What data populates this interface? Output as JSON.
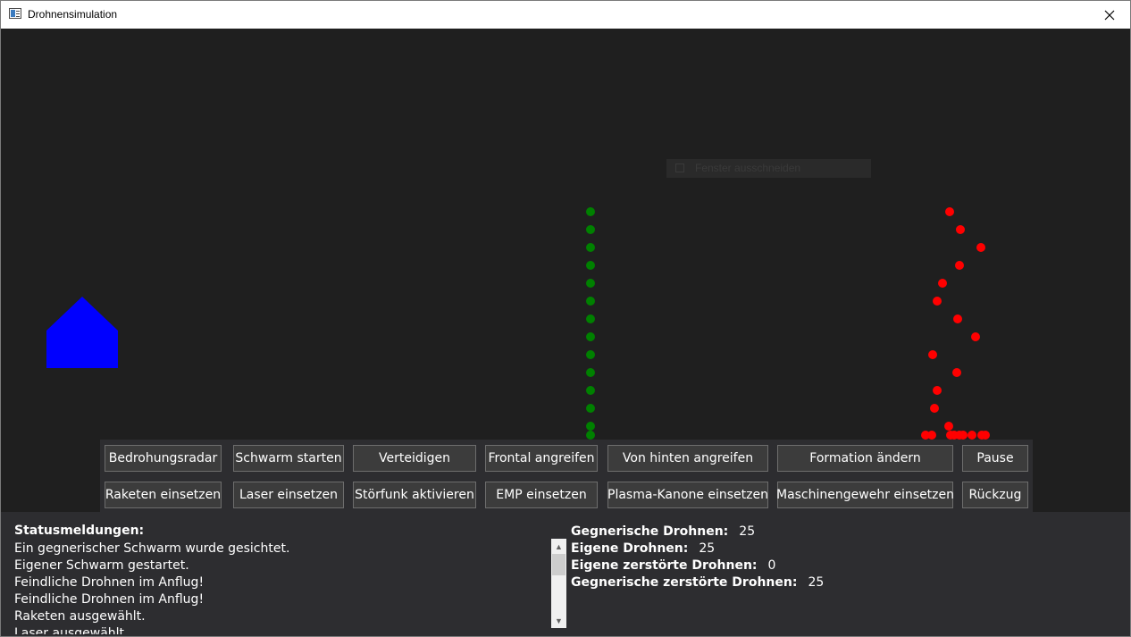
{
  "window": {
    "title": "Drohnensimulation",
    "icon": "app-window-icon",
    "close_icon": "close-icon"
  },
  "canvas": {
    "background": "#1f1f1f",
    "tooltip_text": "Fenster ausschneiden",
    "base": {
      "shape": "house",
      "color": "#0000ff"
    },
    "own_drones": {
      "color": "#008000",
      "count_visible": 14
    },
    "enemy_drones": {
      "color": "#ff0000",
      "count_visible": 22
    }
  },
  "buttons": {
    "row1": [
      "Bedrohungsradar",
      "Schwarm starten",
      "Verteidigen",
      "Frontal angreifen",
      "Von hinten angreifen",
      "Formation ändern",
      "Pause"
    ],
    "row2": [
      "Raketen einsetzen",
      "Laser einsetzen",
      "Störfunk aktivieren",
      "EMP einsetzen",
      "Plasma-Kanone einsetzen",
      "Maschinengewehr einsetzen",
      "Rückzug"
    ]
  },
  "status": {
    "heading": "Statusmeldungen:",
    "messages": [
      "Ein gegnerischer Schwarm wurde gesichtet.",
      "Eigener Schwarm gestartet.",
      "Feindliche Drohnen im Anflug!",
      "Feindliche Drohnen im Anflug!",
      "Raketen ausgewählt.",
      "Laser ausgewählt."
    ]
  },
  "stats": {
    "enemy_drones_label": "Gegnerische Drohnen:",
    "enemy_drones_value": "25",
    "own_drones_label": "Eigene Drohnen:",
    "own_drones_value": "25",
    "own_destroyed_label": "Eigene zerstörte Drohnen:",
    "own_destroyed_value": "0",
    "enemy_destroyed_label": "Gegnerische zerstörte Drohnen:",
    "enemy_destroyed_value": "25"
  }
}
